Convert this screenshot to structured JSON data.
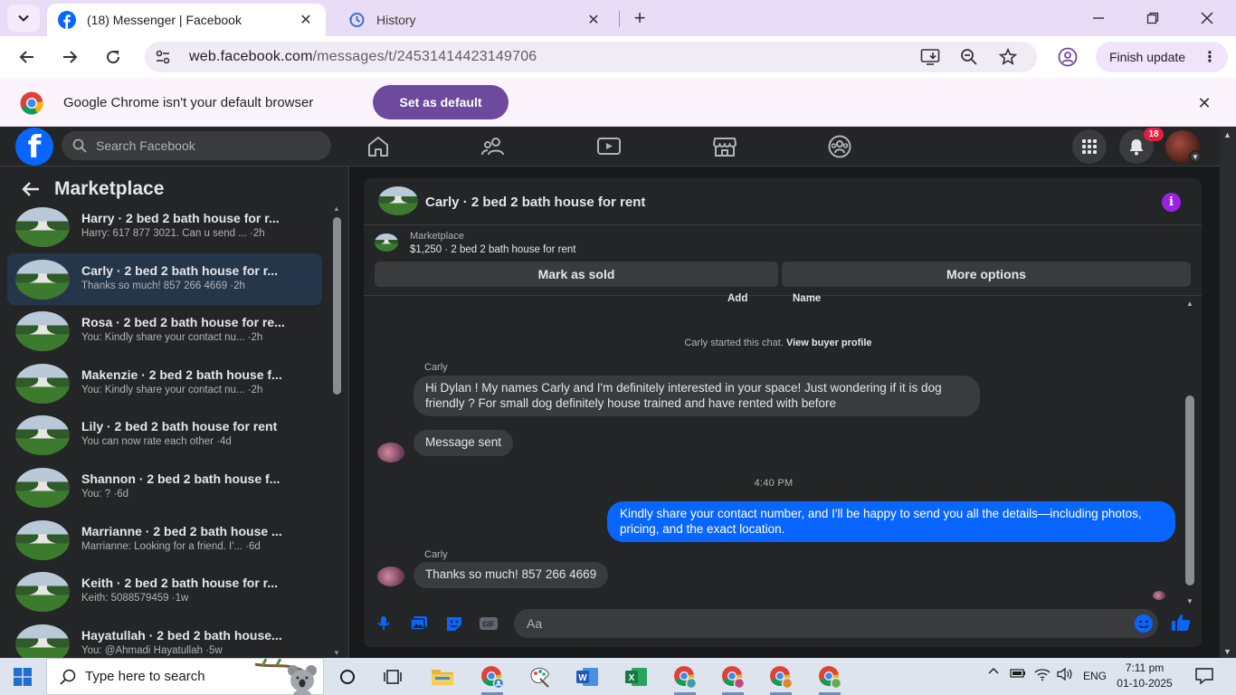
{
  "browser": {
    "tabs": [
      {
        "title": "(18) Messenger | Facebook",
        "active": true
      },
      {
        "title": "History",
        "active": false
      }
    ],
    "url": {
      "host": "web.facebook.com",
      "path": "/messages/t/24531414423149706"
    },
    "finish_update_label": "Finish update",
    "infobar": {
      "message": "Google Chrome isn't your default browser",
      "button": "Set as default"
    }
  },
  "facebook": {
    "search_placeholder": "Search Facebook",
    "notification_count": "18",
    "colors": {
      "accent": "#0866ff",
      "badge": "#e41e3f",
      "info": "#9c21e6"
    }
  },
  "sidebar": {
    "title": "Marketplace",
    "conversations": [
      {
        "name": "Harry · 2 bed 2 bath house for r...",
        "preview": "Harry: 617 877 3021. Can u send ... ·2h",
        "selected": false
      },
      {
        "name": "Carly · 2 bed 2 bath house for r...",
        "preview": "Thanks so much! 857 266 4669 ·2h",
        "selected": true
      },
      {
        "name": "Rosa · 2 bed 2 bath house for re...",
        "preview": "You: Kindly share your contact nu... ·2h",
        "selected": false
      },
      {
        "name": "Makenzie · 2 bed 2 bath house f...",
        "preview": "You: Kindly share your contact nu... ·2h",
        "selected": false
      },
      {
        "name": "Lily · 2 bed 2 bath house for rent",
        "preview": "You can now rate each other ·4d",
        "selected": false
      },
      {
        "name": "Shannon · 2 bed 2 bath house f...",
        "preview": "You: ? ·6d",
        "selected": false
      },
      {
        "name": "Marrianne · 2 bed 2 bath house ...",
        "preview": "Marrianne: Looking for a friend. I'... ·6d",
        "selected": false
      },
      {
        "name": "Keith · 2 bed 2 bath house for r...",
        "preview": "Keith: 5088579459 ·1w",
        "selected": false
      },
      {
        "name": "Hayatullah · 2 bed 2 bath house...",
        "preview": "You: @Ahmadi Hayatullah ·5w",
        "selected": false
      }
    ]
  },
  "chat": {
    "title": "Carly · 2 bed 2 bath house for rent",
    "listing": {
      "category": "Marketplace",
      "price_title": "$1,250 · 2 bed 2 bath house for rent"
    },
    "mark_sold_label": "Mark as sold",
    "more_options_label": "More options",
    "add_label": "Add",
    "name_label": "Name",
    "system_note": "Carly started this chat.",
    "view_profile_link": "View buyer profile",
    "messages": [
      {
        "sender": "Carly",
        "text": "Hi Dylan ! My names Carly and I'm definitely interested in your space! Just wondering if it is dog friendly ? For small dog definitely house trained and have rented with before"
      },
      {
        "text": "Message sent"
      },
      {
        "time": "4:40 PM"
      },
      {
        "text": "Kindly share your contact number, and I'll be happy to send you all the details—including photos, pricing, and the exact location."
      },
      {
        "sender": "Carly",
        "text": "Thanks so much! 857 266 4669"
      }
    ],
    "composer_placeholder": "Aa"
  },
  "taskbar": {
    "search_placeholder": "Type here to search",
    "language": "ENG",
    "time": "7:11 pm",
    "date": "01-10-2025"
  }
}
